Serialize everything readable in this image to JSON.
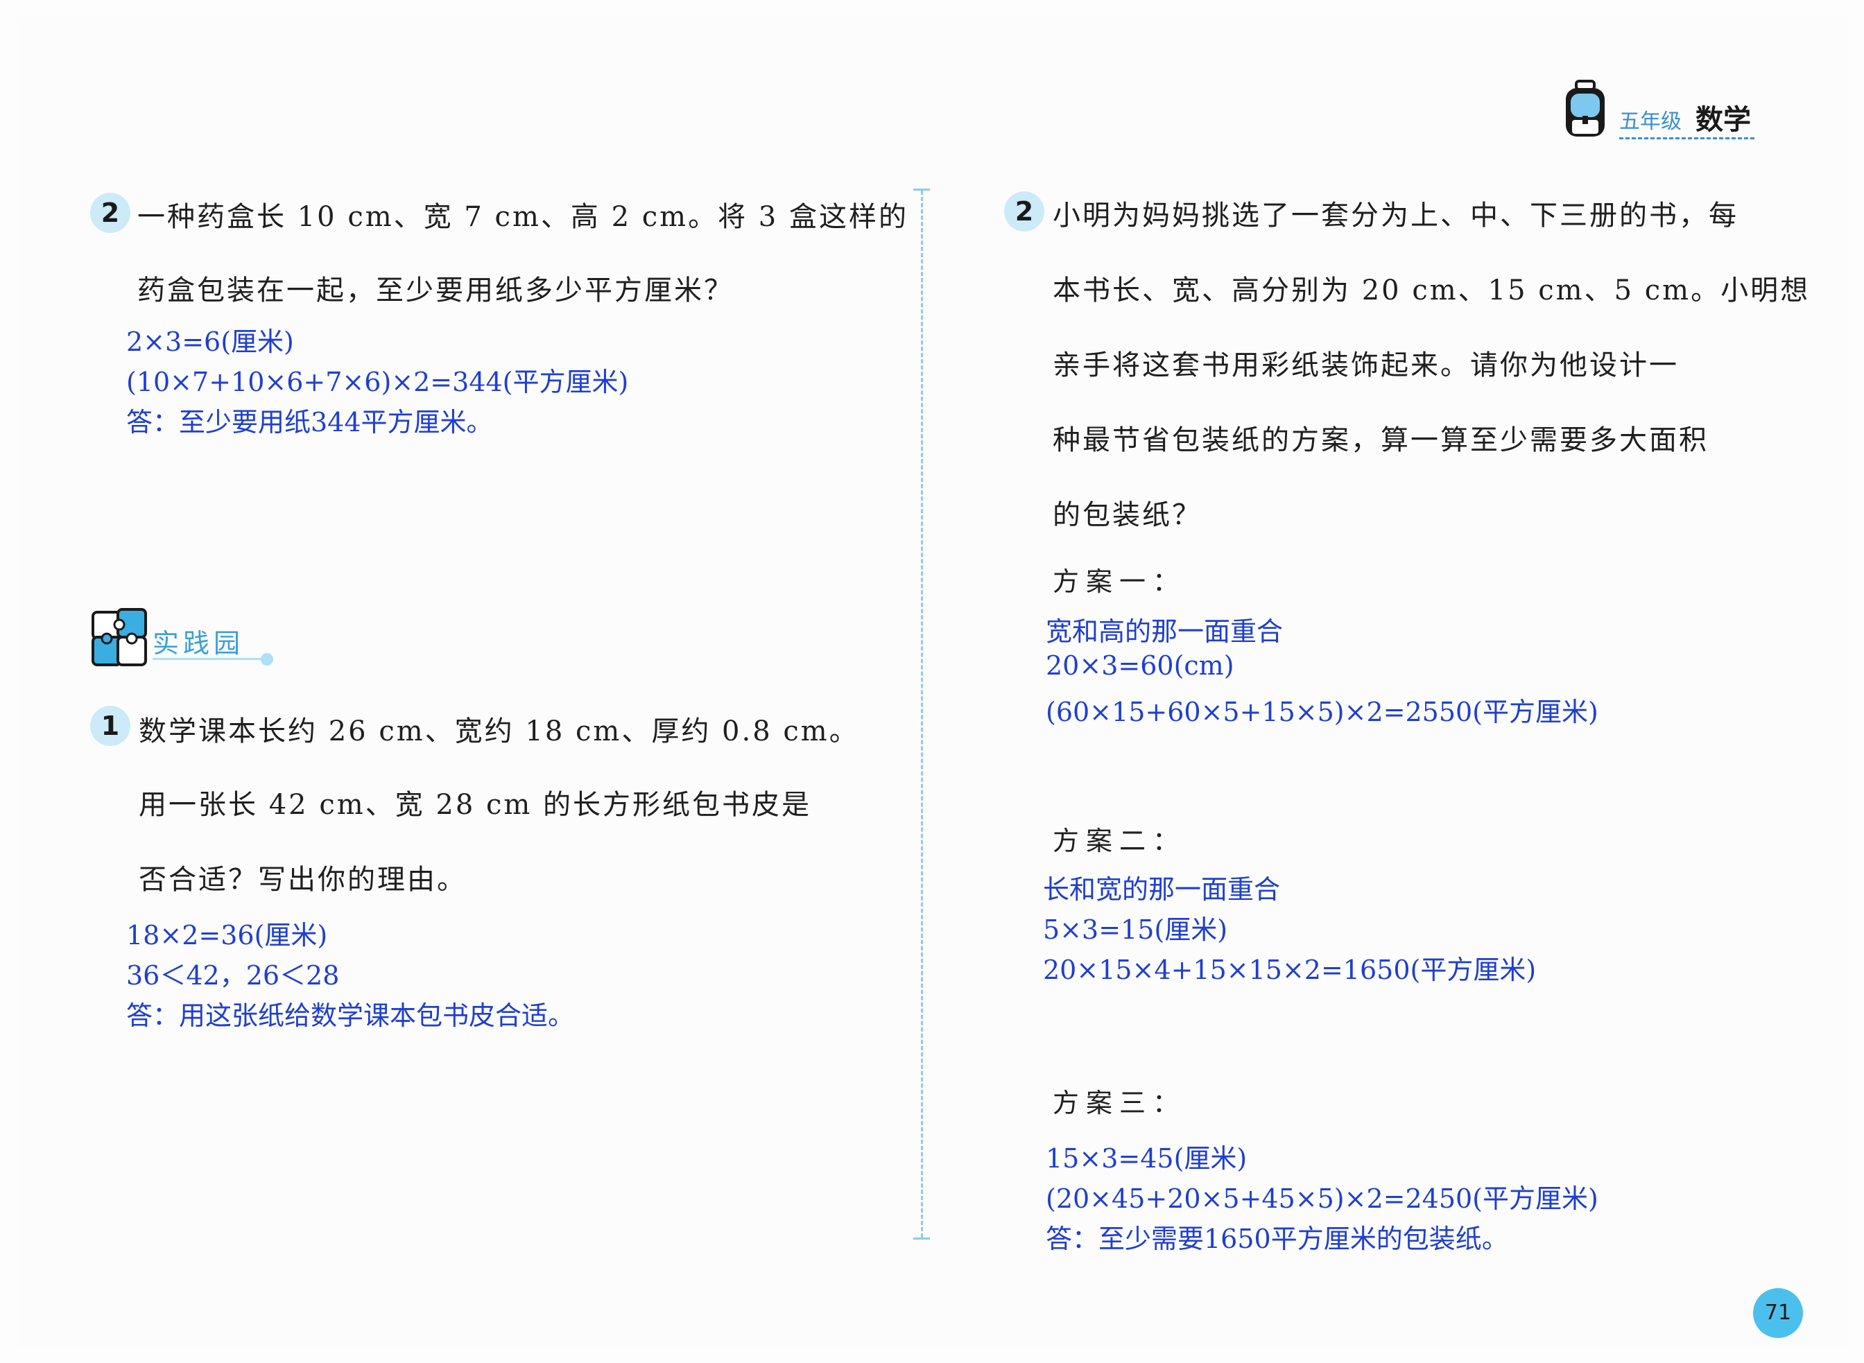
{
  "header": {
    "grade": "五年级",
    "subject": "数学"
  },
  "left": {
    "q2": {
      "number": "2",
      "lines": [
        "一种药盒长 10 cm、宽 7 cm、高 2 cm。将 3 盒这样的",
        "药盒包装在一起，至少要用纸多少平方厘米？"
      ],
      "answers": [
        "2×3=6(厘米)",
        "(10×7+10×6+7×6)×2=344(平方厘米)",
        "答：至少要用纸344平方厘米。"
      ]
    },
    "section": {
      "title": "实践园"
    },
    "q1": {
      "number": "1",
      "lines": [
        "数学课本长约 26 cm、宽约 18 cm、厚约 0.8 cm。",
        "用一张长 42 cm、宽 28 cm 的长方形纸包书皮是",
        "否合适？写出你的理由。"
      ],
      "answers": [
        "18×2=36(厘米)",
        "36＜42，26＜28",
        "答：用这张纸给数学课本包书皮合适。"
      ]
    }
  },
  "right": {
    "q2": {
      "number": "2",
      "lines": [
        "小明为妈妈挑选了一套分为上、中、下三册的书，每",
        "本书长、宽、高分别为 20 cm、15 cm、5 cm。小明想",
        "亲手将这套书用彩纸装饰起来。请你为他设计一",
        "种最节省包装纸的方案，算一算至少需要多大面积",
        "的包装纸？"
      ]
    },
    "plans": [
      {
        "label": "方案一：",
        "answers": [
          "宽和高的那一面重合",
          "20×3=60(cm)",
          "(60×15+60×5+15×5)×2=2550(平方厘米)"
        ]
      },
      {
        "label": "方案二：",
        "answers": [
          "长和宽的那一面重合",
          "5×3=15(厘米)",
          "20×15×4+15×15×2=1650(平方厘米)"
        ]
      },
      {
        "label": "方案三：",
        "answers": [
          "15×3=45(厘米)",
          "(20×45+20×5+45×5)×2=2450(平方厘米)",
          "答：至少需要1650平方厘米的包装纸。"
        ]
      }
    ]
  },
  "page_number": "71",
  "colors": {
    "answer_blue": "#1f3fd0",
    "accent": "#3a8fd0",
    "badge": "#cdeaf8"
  },
  "icons": [
    "schoolbag-icon",
    "puzzle-icon"
  ]
}
